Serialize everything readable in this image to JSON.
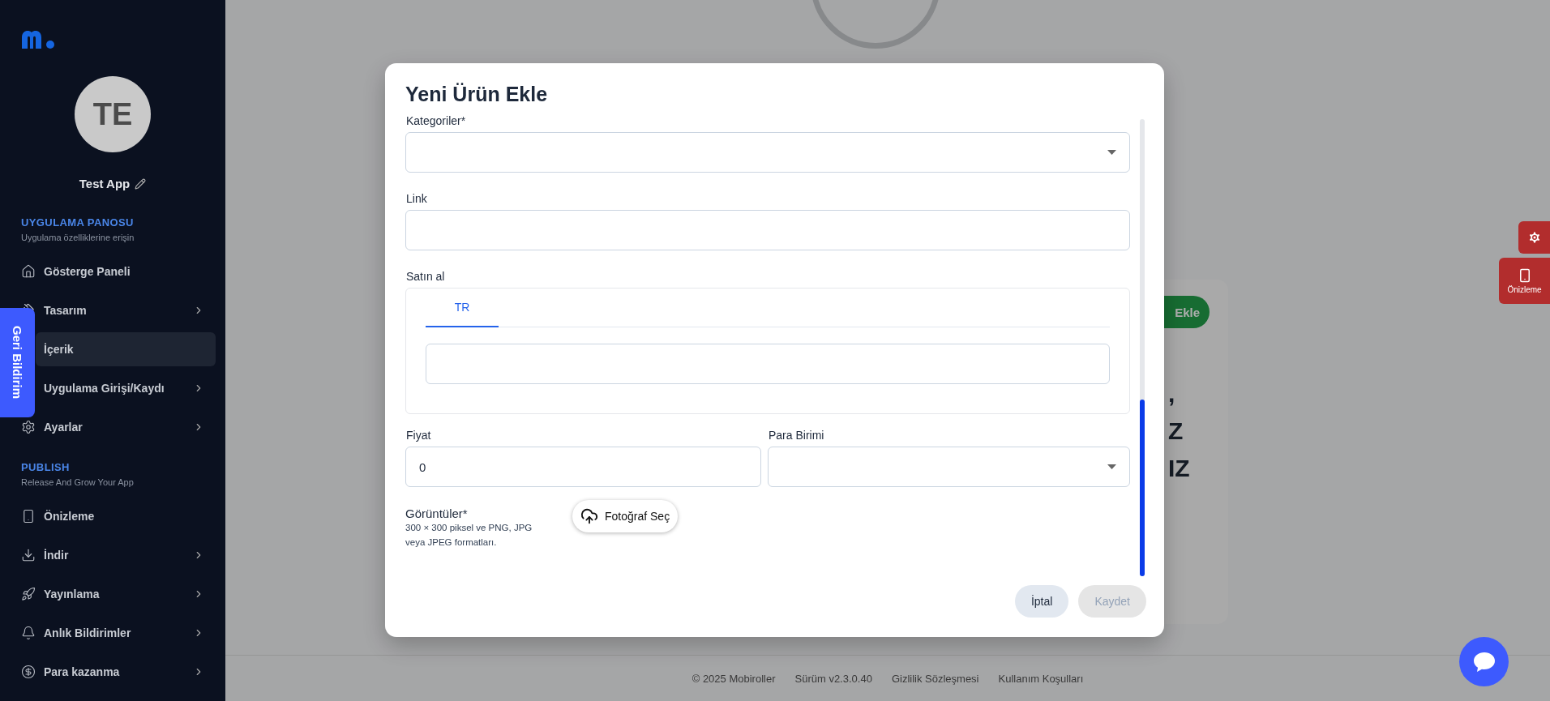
{
  "sidebar": {
    "avatar_initials": "TE",
    "app_name": "Test App",
    "sections": [
      {
        "title": "UYGULAMA PANOSU",
        "subtitle": "Uygulama özelliklerine erişin",
        "items": [
          {
            "label": "Gösterge Paneli",
            "selected": false,
            "has_submenu": false
          },
          {
            "label": "Tasarım",
            "selected": false,
            "has_submenu": true
          },
          {
            "label": "İçerik",
            "selected": true,
            "has_submenu": false
          },
          {
            "label": "Uygulama Girişi/Kaydı",
            "selected": false,
            "has_submenu": true
          },
          {
            "label": "Ayarlar",
            "selected": false,
            "has_submenu": true
          }
        ]
      },
      {
        "title": "PUBLISH",
        "subtitle": "Release And Grow Your App",
        "items": [
          {
            "label": "Önizleme",
            "selected": false,
            "has_submenu": false
          },
          {
            "label": "İndir",
            "selected": false,
            "has_submenu": true
          },
          {
            "label": "Yayınlama",
            "selected": false,
            "has_submenu": true
          },
          {
            "label": "Anlık Bildirimler",
            "selected": false,
            "has_submenu": true
          },
          {
            "label": "Para kazanma",
            "selected": false,
            "has_submenu": true
          }
        ]
      }
    ]
  },
  "feedback_tab": "Geri Bildirim",
  "background": {
    "add_button": "Ekle",
    "text_lines": [
      ",",
      "Z",
      "IZ"
    ]
  },
  "preview_button": "Önizleme",
  "footer": [
    "© 2025 Mobiroller",
    "Sürüm v2.3.0.40",
    "Gizlilik Sözleşmesi",
    "Kullanım Koşulları"
  ],
  "modal": {
    "title": "Yeni Ürün Ekle",
    "categories": {
      "label": "Kategoriler*"
    },
    "link": {
      "label": "Link"
    },
    "buy": {
      "label": "Satın al",
      "tabs": [
        {
          "label": "TR",
          "selected": true
        }
      ]
    },
    "price": {
      "label": "Fiyat",
      "value": "0"
    },
    "currency": {
      "label": "Para Birimi"
    },
    "images": {
      "label": "Görüntüler*",
      "hint": "300 × 300 piksel ve PNG, JPG veya JPEG formatları.",
      "button": "Fotoğraf Seç"
    },
    "cancel": {
      "label": "İptal",
      "disabled": false
    },
    "save": {
      "label": "Kaydet",
      "disabled": true
    }
  }
}
